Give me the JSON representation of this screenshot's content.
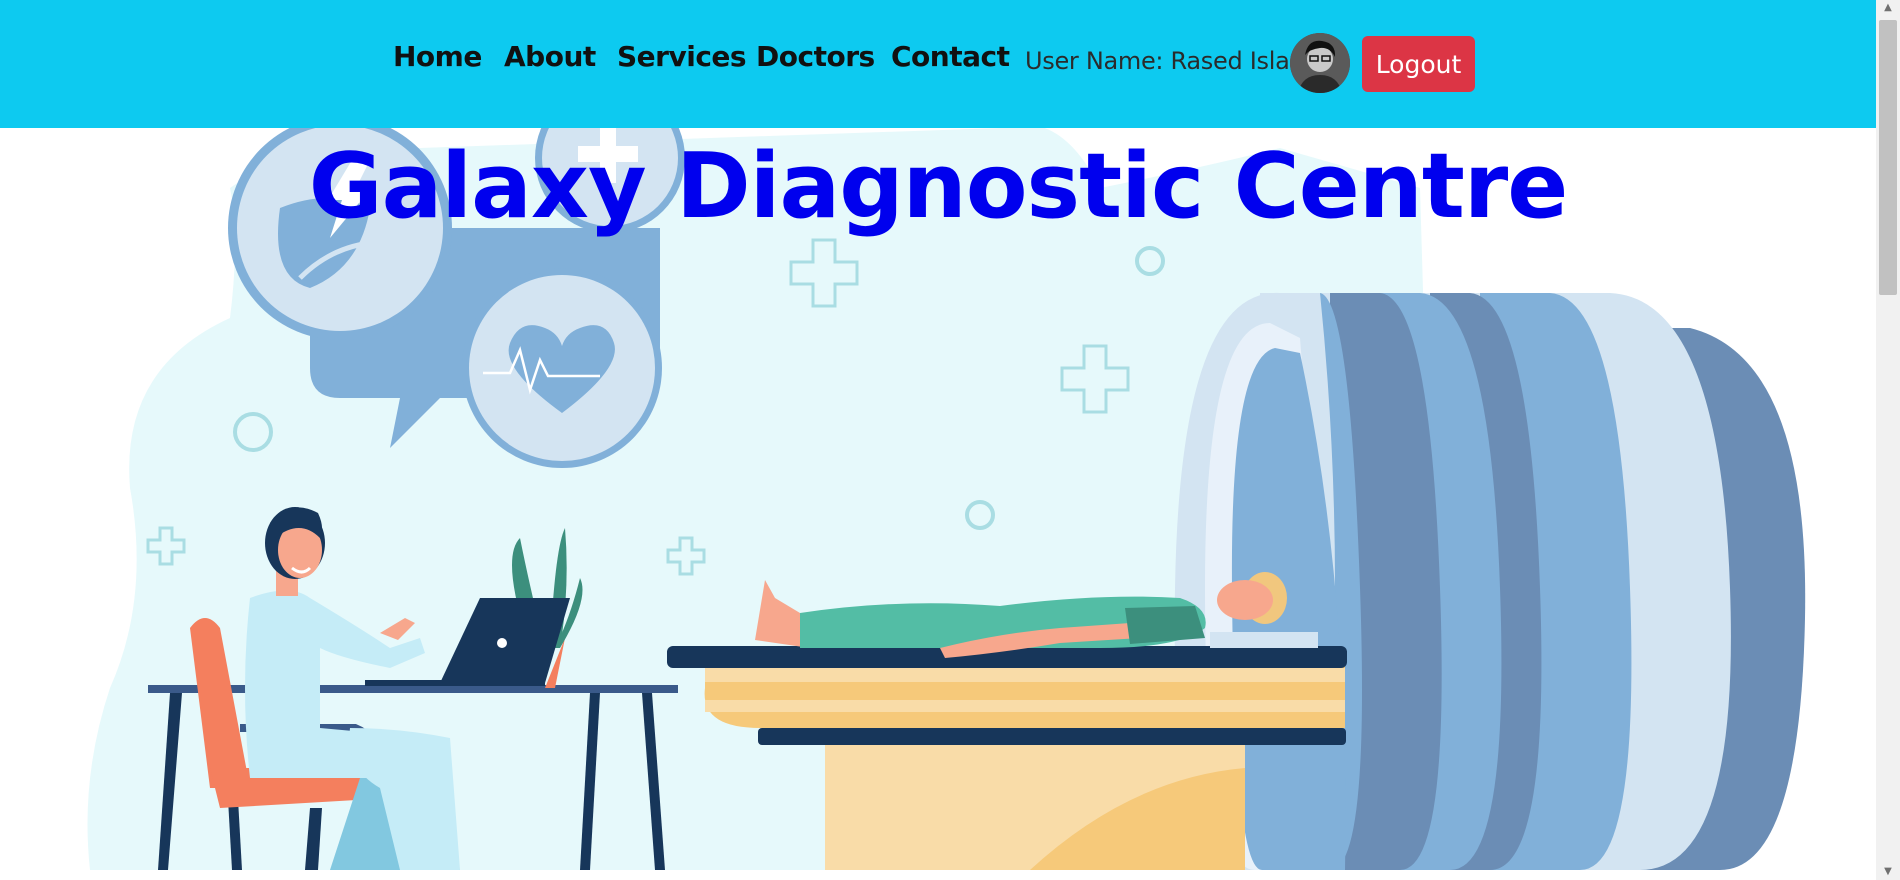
{
  "nav": {
    "items": [
      {
        "label": "Home"
      },
      {
        "label": "About"
      },
      {
        "label": "Services"
      },
      {
        "label": "Doctors"
      },
      {
        "label": "Contact"
      }
    ],
    "user_name": "User Name: Rased Islam",
    "avatar_icon": "user-photo",
    "logout_label": "Logout"
  },
  "hero": {
    "title": "Galaxy Diagnostic Centre",
    "illustration": "doctor-and-mri-scanner-illustration"
  },
  "colors": {
    "navbar": "#0dcaf0",
    "title": "#0000ee",
    "logout": "#dc3545"
  }
}
